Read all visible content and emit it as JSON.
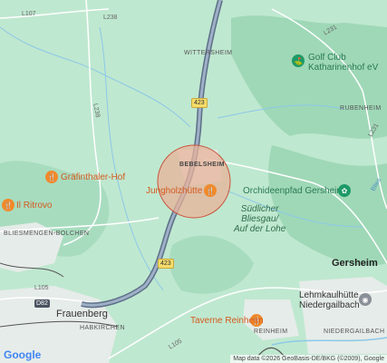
{
  "map": {
    "colors": {
      "land": "#bfe8d0",
      "forest": "#9fd8b7",
      "highway": "#7c8fa8",
      "marker_fill": "#e8b39a",
      "marker_stroke": "#c8553d",
      "poi_food": "#f08a2c",
      "poi_green": "#1e9a68"
    },
    "roads": {
      "l107": "L107",
      "l238_top": "L238",
      "l238_left": "L238",
      "l231_top": "L231",
      "l231_right": "L231",
      "l105_left": "L105",
      "l105_bottom": "L105",
      "b423_top": "423",
      "b423_mid": "423",
      "d82": "D82",
      "blies": "Blies"
    },
    "places": {
      "wittersheim": "WITTERSHEIM",
      "rubenheim": "RUBENHEIM",
      "bebelsheim": "BEBELSHEIM",
      "bliesmengen": "BLIESMENGEN-BOLCHEN",
      "gersheim": "Gersheim",
      "frauenberg": "Frauenberg",
      "habkirchen": "HABKIRCHEN",
      "reinheim": "REINHEIM",
      "niedergailbach": "NIEDERGAILBACH",
      "nature_area_1": "Südlicher",
      "nature_area_2": "Bliesgau/",
      "nature_area_3": "Auf der Lohe"
    },
    "pois": {
      "golf_line1": "Golf Club",
      "golf_line2": "Katharinenhof eV",
      "graefinthaler": "Gräfinthaler-Hof",
      "ritrovo": "Il Ritrovo",
      "jungholzhuette": "Jungholzhütte",
      "orchideenpfad": "Orchideenpfad Gersheim",
      "taverne": "Taverne Reinheim",
      "lehmkaul_line1": "Lehmkaulhütte",
      "lehmkaul_line2": "Niedergailbach"
    },
    "attribution": "Map data ©2026 GeoBasis-DE/BKG (©2009), Google",
    "logo": "Google"
  }
}
